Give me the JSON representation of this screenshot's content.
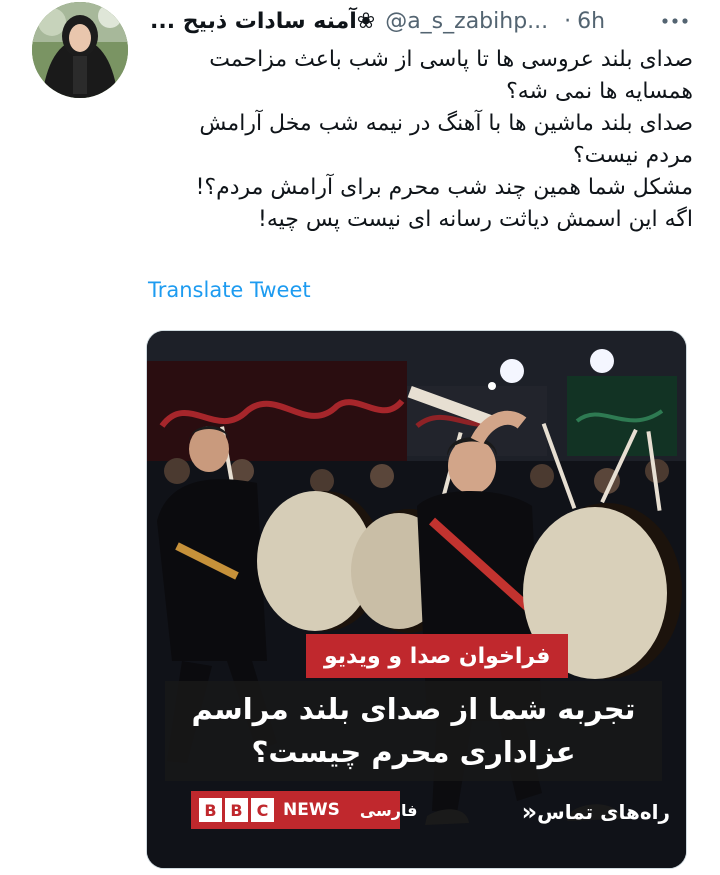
{
  "tweet": {
    "display_name": "آمنه سادات ذبیح ...",
    "verified_icon": "flower-icon",
    "verified_glyph": "❀",
    "handle": "@a_s_zabihp...",
    "dot": "·",
    "time": "6h",
    "more_icon": "more-icon",
    "body_lines": [
      "صدای بلند عروسی ها تا پاسی از شب باعث مزاحمت",
      "همسایه ها نمی شه؟",
      "صدای بلند ماشین ها با آهنگ در نیمه شب مخل آرامش",
      "مردم نیست؟",
      "مشکل شما همین چند شب محرم برای آرامش مردم؟!",
      "اگه این اسمش دیاثت رسانه ای نیست پس چیه!"
    ],
    "translate_label": "Translate Tweet"
  },
  "card": {
    "tag": "فراخوان صدا و ویدیو",
    "headline_lines": [
      "تجربه شما از صدای بلند مراسم",
      "عزاداری محرم چیست؟"
    ],
    "brand_letters": [
      "B",
      "B",
      "C"
    ],
    "brand_news": "NEWS",
    "brand_language": "فارسی",
    "contact_label": "راه‌های تماس",
    "contact_arrow": "«",
    "colors": {
      "brand_red": "#c0282d",
      "link_blue": "#1d9bf0",
      "muted": "#536471"
    }
  }
}
